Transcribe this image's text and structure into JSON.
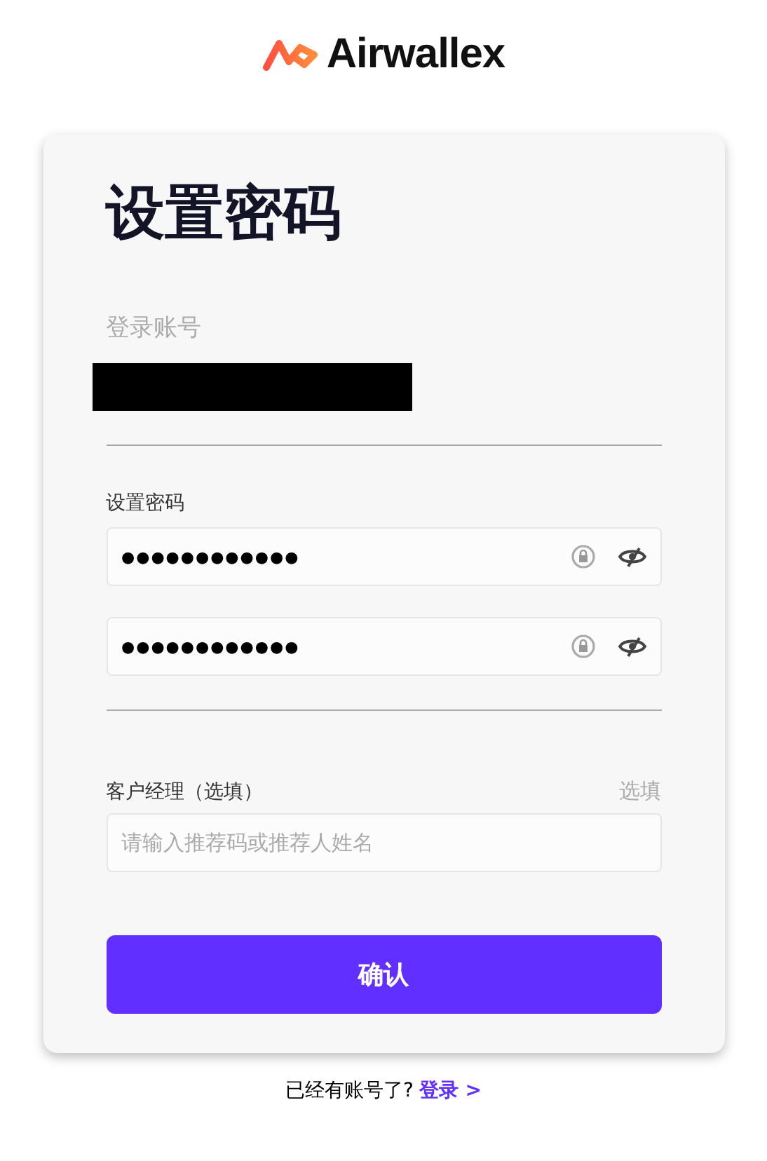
{
  "brand": {
    "name": "Airwallex"
  },
  "card": {
    "title": "设置密码",
    "account_label": "登录账号",
    "account_redacted": true,
    "password_label": "设置密码",
    "password_fields": [
      {
        "value": "●●●●●●●●●●●●"
      },
      {
        "value": "●●●●●●●●●●●●"
      }
    ],
    "manager_label": "客户经理（选填）",
    "manager_optional": "选填",
    "manager_placeholder": "请输入推荐码或推荐人姓名",
    "submit": "确认"
  },
  "footer": {
    "text": "已经有账号了?",
    "link": "登录 >"
  }
}
